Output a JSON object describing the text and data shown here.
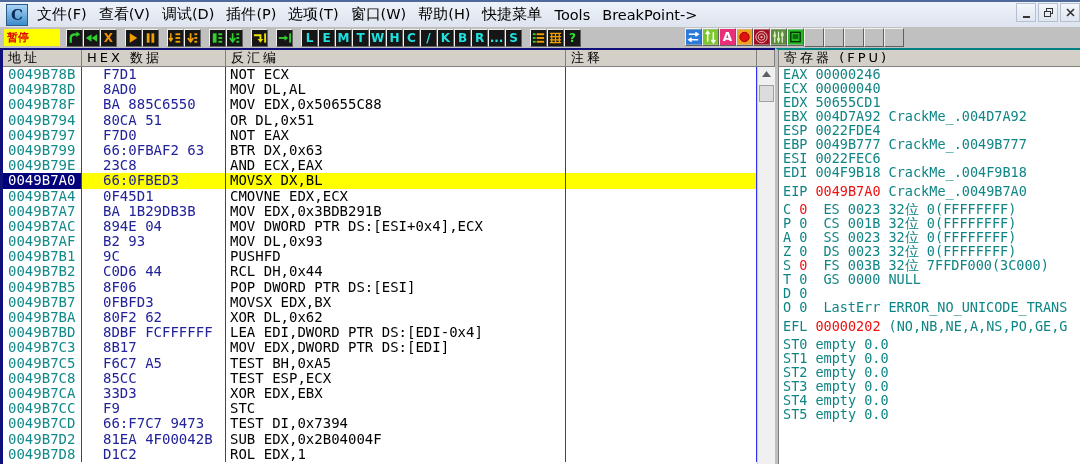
{
  "logo": "C",
  "menu": {
    "items": [
      "文件(F)",
      "查看(V)",
      "调试(D)",
      "插件(P)",
      "选项(T)",
      "窗口(W)",
      "帮助(H)",
      "快捷菜单",
      "Tools",
      "BreakPoint->"
    ]
  },
  "toolbar": {
    "status": "暂停",
    "groups": [
      [
        {
          "kind": "icon"
        },
        {
          "kind": "icon"
        },
        {
          "kind": "warn",
          "label": "X"
        }
      ],
      [
        {
          "kind": "icon"
        },
        {
          "kind": "icon"
        }
      ],
      [
        {
          "kind": "icon"
        },
        {
          "kind": "icon"
        }
      ],
      [
        {
          "kind": "icon"
        },
        {
          "kind": "icon"
        }
      ],
      [
        {
          "kind": "icon"
        }
      ],
      [
        {
          "kind": "icon"
        }
      ],
      [
        {
          "kind": "key",
          "label": "L"
        },
        {
          "kind": "key",
          "label": "E"
        },
        {
          "kind": "key",
          "label": "M"
        },
        {
          "kind": "key",
          "label": "T"
        },
        {
          "kind": "key",
          "label": "W"
        },
        {
          "kind": "key",
          "label": "H"
        },
        {
          "kind": "key",
          "label": "C"
        },
        {
          "kind": "key",
          "label": "/"
        },
        {
          "kind": "key",
          "label": "K"
        },
        {
          "kind": "key",
          "label": "B"
        },
        {
          "kind": "key",
          "label": "R"
        },
        {
          "kind": "key",
          "label": "..."
        },
        {
          "kind": "key",
          "label": "S"
        }
      ],
      [
        {
          "kind": "icon"
        },
        {
          "kind": "icon"
        },
        {
          "kind": "help",
          "label": "?"
        }
      ]
    ],
    "right_groups": [
      [
        {
          "kind": "icon"
        },
        {
          "kind": "icon"
        },
        {
          "kind": "font",
          "label": "A"
        },
        {
          "kind": "icon"
        },
        {
          "kind": "icon"
        },
        {
          "kind": "icon"
        },
        {
          "kind": "icon"
        },
        {
          "kind": "blank"
        },
        {
          "kind": "blank"
        },
        {
          "kind": "blank"
        },
        {
          "kind": "blank"
        },
        {
          "kind": "blank"
        }
      ]
    ]
  },
  "disasm": {
    "columns": [
      "地址",
      "HEX 数据",
      "反汇编",
      "注释"
    ],
    "rows": [
      {
        "address": "0049B78B",
        "hex": "F7D1",
        "instruction": "NOT ECX",
        "selected": false
      },
      {
        "address": "0049B78D",
        "hex": "8AD0",
        "instruction": "MOV DL,AL",
        "selected": false
      },
      {
        "address": "0049B78F",
        "hex": "BA 885C6550",
        "instruction": "MOV EDX,0x50655C88",
        "selected": false
      },
      {
        "address": "0049B794",
        "hex": "80CA 51",
        "instruction": "OR DL,0x51",
        "selected": false
      },
      {
        "address": "0049B797",
        "hex": "F7D0",
        "instruction": "NOT EAX",
        "selected": false
      },
      {
        "address": "0049B799",
        "hex": "66:0FBAF2 63",
        "instruction": "BTR DX,0x63",
        "selected": false
      },
      {
        "address": "0049B79E",
        "hex": "23C8",
        "instruction": "AND ECX,EAX",
        "selected": false
      },
      {
        "address": "0049B7A0",
        "hex": "66:0FBED3",
        "instruction": "MOVSX DX,BL",
        "selected": true
      },
      {
        "address": "0049B7A4",
        "hex": "0F45D1",
        "instruction": "CMOVNE EDX,ECX",
        "selected": false
      },
      {
        "address": "0049B7A7",
        "hex": "BA 1B29DB3B",
        "instruction": "MOV EDX,0x3BDB291B",
        "selected": false
      },
      {
        "address": "0049B7AC",
        "hex": "894E 04",
        "instruction": "MOV DWORD PTR DS:[ESI+0x4],ECX",
        "selected": false
      },
      {
        "address": "0049B7AF",
        "hex": "B2 93",
        "instruction": "MOV DL,0x93",
        "selected": false
      },
      {
        "address": "0049B7B1",
        "hex": "9C",
        "instruction": "PUSHFD",
        "selected": false
      },
      {
        "address": "0049B7B2",
        "hex": "C0D6 44",
        "instruction": "RCL DH,0x44",
        "selected": false
      },
      {
        "address": "0049B7B5",
        "hex": "8F06",
        "instruction": "POP DWORD PTR DS:[ESI]",
        "selected": false
      },
      {
        "address": "0049B7B7",
        "hex": "0FBFD3",
        "instruction": "MOVSX EDX,BX",
        "selected": false
      },
      {
        "address": "0049B7BA",
        "hex": "80F2 62",
        "instruction": "XOR DL,0x62",
        "selected": false
      },
      {
        "address": "0049B7BD",
        "hex": "8DBF FCFFFFFF",
        "instruction": "LEA EDI,DWORD PTR DS:[EDI-0x4]",
        "selected": false
      },
      {
        "address": "0049B7C3",
        "hex": "8B17",
        "instruction": "MOV EDX,DWORD PTR DS:[EDI]",
        "selected": false
      },
      {
        "address": "0049B7C5",
        "hex": "F6C7 A5",
        "instruction": "TEST BH,0xA5",
        "selected": false
      },
      {
        "address": "0049B7C8",
        "hex": "85CC",
        "instruction": "TEST ESP,ECX",
        "selected": false
      },
      {
        "address": "0049B7CA",
        "hex": "33D3",
        "instruction": "XOR EDX,EBX",
        "selected": false
      },
      {
        "address": "0049B7CC",
        "hex": "F9",
        "instruction": "STC",
        "selected": false
      },
      {
        "address": "0049B7CD",
        "hex": "66:F7C7 9473",
        "instruction": "TEST DI,0x7394",
        "selected": false
      },
      {
        "address": "0049B7D2",
        "hex": "81EA 4F00042B",
        "instruction": "SUB EDX,0x2B04004F",
        "selected": false
      },
      {
        "address": "0049B7D8",
        "hex": "D1C2",
        "instruction": "ROL EDX,1",
        "selected": false
      }
    ]
  },
  "registers": {
    "title": "寄存器 (FPU)",
    "groups": [
      {
        "rows": [
          {
            "kind": "reg",
            "name": "EAX",
            "value": "00000246",
            "changed": false
          },
          {
            "kind": "reg",
            "name": "ECX",
            "value": "00000040",
            "changed": false
          },
          {
            "kind": "reg",
            "name": "EDX",
            "value": "50655CD1",
            "changed": false
          },
          {
            "kind": "reg",
            "name": "EBX",
            "value": "004D7A92",
            "changed": false,
            "comment": "CrackMe_.004D7A92"
          },
          {
            "kind": "reg",
            "name": "ESP",
            "value": "0022FDE4",
            "changed": false
          },
          {
            "kind": "reg",
            "name": "EBP",
            "value": "0049B777",
            "changed": false,
            "comment": "CrackMe_.0049B777"
          },
          {
            "kind": "reg",
            "name": "ESI",
            "value": "0022FEC6",
            "changed": false
          },
          {
            "kind": "reg",
            "name": "EDI",
            "value": "004F9B18",
            "changed": false,
            "comment": "CrackMe_.004F9B18"
          }
        ]
      },
      {
        "rows": [
          {
            "kind": "reg",
            "name": "EIP",
            "value": "0049B7A0",
            "changed": true,
            "comment": "CrackMe_.0049B7A0"
          }
        ]
      },
      {
        "rows": [
          {
            "kind": "flag",
            "name": "C",
            "value": "0",
            "changed": true,
            "detail": "ES 0023 32位 0(FFFFFFFF)"
          },
          {
            "kind": "flag",
            "name": "P",
            "value": "0",
            "changed": false,
            "detail": "CS 001B 32位 0(FFFFFFFF)"
          },
          {
            "kind": "flag",
            "name": "A",
            "value": "0",
            "changed": false,
            "detail": "SS 0023 32位 0(FFFFFFFF)"
          },
          {
            "kind": "flag",
            "name": "Z",
            "value": "0",
            "changed": false,
            "detail": "DS 0023 32位 0(FFFFFFFF)"
          },
          {
            "kind": "flag",
            "name": "S",
            "value": "0",
            "changed": true,
            "detail": "FS 003B 32位 7FFDF000(3C000)"
          },
          {
            "kind": "flag",
            "name": "T",
            "value": "0",
            "changed": false,
            "detail": "GS 0000 NULL"
          },
          {
            "kind": "flag",
            "name": "D",
            "value": "0",
            "changed": false
          },
          {
            "kind": "flag",
            "name": "O",
            "value": "0",
            "changed": false,
            "detail": "LastErr ERROR_NO_UNICODE_TRANS"
          }
        ]
      },
      {
        "rows": [
          {
            "kind": "reg",
            "name": "EFL",
            "value": "00000202",
            "changed": true,
            "comment": "(NO,NB,NE,A,NS,PO,GE,G"
          }
        ]
      },
      {
        "rows": [
          {
            "kind": "reg",
            "name": "ST0",
            "value": "empty",
            "changed": false,
            "comment": "0.0"
          },
          {
            "kind": "reg",
            "name": "ST1",
            "value": "empty",
            "changed": false,
            "comment": "0.0"
          },
          {
            "kind": "reg",
            "name": "ST2",
            "value": "empty",
            "changed": false,
            "comment": "0.0"
          },
          {
            "kind": "reg",
            "name": "ST3",
            "value": "empty",
            "changed": false,
            "comment": "0.0"
          },
          {
            "kind": "reg",
            "name": "ST4",
            "value": "empty",
            "changed": false,
            "comment": "0.0"
          },
          {
            "kind": "reg",
            "name": "ST5",
            "value": "empty",
            "changed": false,
            "comment": "0.0"
          }
        ]
      }
    ]
  }
}
